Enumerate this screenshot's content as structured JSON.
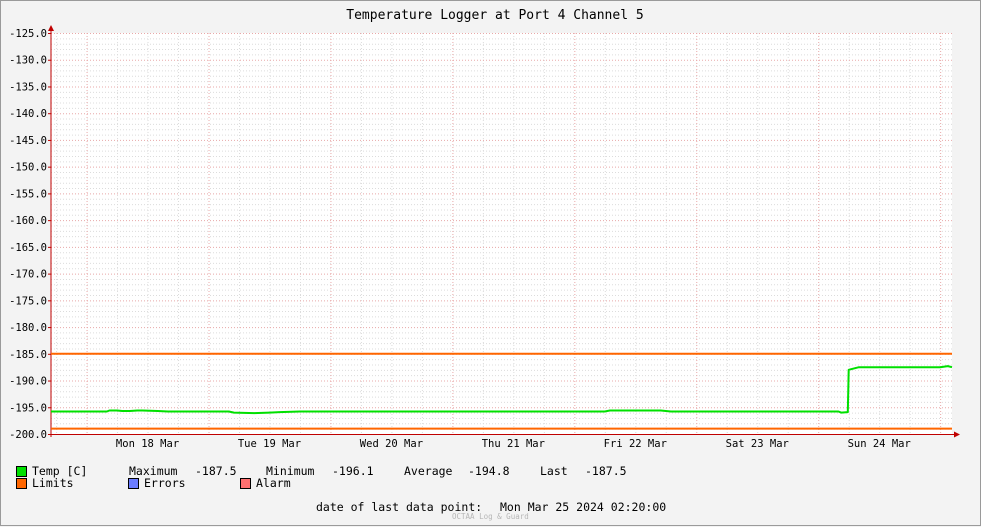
{
  "chart_data": {
    "type": "line",
    "title": "Temperature Logger at Port 4 Channel 5",
    "xlabel": "",
    "ylabel": "",
    "ylim": [
      -200.0,
      -125.0
    ],
    "yticks": [
      -125.0,
      -130.0,
      -135.0,
      -140.0,
      -145.0,
      -150.0,
      -155.0,
      -160.0,
      -165.0,
      -170.0,
      -175.0,
      -180.0,
      -185.0,
      -190.0,
      -195.0,
      -200.0
    ],
    "ytick_labels": [
      "-125.0",
      "-130.0",
      "-135.0",
      "-140.0",
      "-145.0",
      "-150.0",
      "-155.0",
      "-160.0",
      "-165.0",
      "-170.0",
      "-175.0",
      "-180.0",
      "-185.0",
      "-190.0",
      "-195.0",
      "-200.0"
    ],
    "xlim": [
      "2024-03-17 17:00",
      "2024-03-25 02:20"
    ],
    "xticks": [
      "2024-03-18 12:00",
      "2024-03-19 12:00",
      "2024-03-20 12:00",
      "2024-03-21 12:00",
      "2024-03-22 12:00",
      "2024-03-23 12:00",
      "2024-03-24 12:00"
    ],
    "xtick_labels": [
      "Mon 18 Mar",
      "Tue 19 Mar",
      "Wed 20 Mar",
      "Thu 21 Mar",
      "Fri 22 Mar",
      "Sat 23 Mar",
      "Sun 24 Mar"
    ],
    "grid": true,
    "legend_position": "bottom-left",
    "series": [
      {
        "name": "Temp [C]",
        "color": "#00e000",
        "x": [
          "2024-03-17 17:00",
          "2024-03-18 04:00",
          "2024-03-18 04:30",
          "2024-03-18 06:00",
          "2024-03-18 07:00",
          "2024-03-18 08:30",
          "2024-03-18 10:00",
          "2024-03-18 11:00",
          "2024-03-18 14:00",
          "2024-03-18 16:00",
          "2024-03-18 22:00",
          "2024-03-19 04:00",
          "2024-03-19 05:00",
          "2024-03-19 09:00",
          "2024-03-19 12:00",
          "2024-03-19 14:00",
          "2024-03-19 18:00",
          "2024-03-20 12:00",
          "2024-03-21 12:00",
          "2024-03-22 06:00",
          "2024-03-22 07:00",
          "2024-03-22 09:00",
          "2024-03-22 17:00",
          "2024-03-22 19:00",
          "2024-03-23 12:00",
          "2024-03-23 18:00",
          "2024-03-24 04:00",
          "2024-03-24 04:30",
          "2024-03-24 05:50",
          "2024-03-24 06:00",
          "2024-03-24 08:00",
          "2024-03-24 12:00",
          "2024-03-24 18:00",
          "2024-03-25 00:00",
          "2024-03-25 01:30",
          "2024-03-25 02:20"
        ],
        "y": [
          -195.8,
          -195.8,
          -195.6,
          -195.6,
          -195.7,
          -195.7,
          -195.6,
          -195.6,
          -195.7,
          -195.8,
          -195.8,
          -195.8,
          -196.0,
          -196.1,
          -196.0,
          -195.9,
          -195.8,
          -195.8,
          -195.8,
          -195.8,
          -195.6,
          -195.6,
          -195.6,
          -195.8,
          -195.8,
          -195.8,
          -195.8,
          -196.0,
          -195.9,
          -188.0,
          -187.5,
          -187.5,
          -187.5,
          -187.5,
          -187.3,
          -187.5
        ]
      },
      {
        "name": "Limits",
        "color": "#ff6600",
        "levels": [
          -185.0,
          -199.0
        ]
      },
      {
        "name": "Errors",
        "color": "#6b7cff"
      },
      {
        "name": "Alarm",
        "color": "#ff7070"
      }
    ]
  },
  "stats": {
    "maximum_label": "Maximum",
    "maximum": "-187.5",
    "minimum_label": "Minimum",
    "minimum": "-196.1",
    "average_label": "Average",
    "average": "-194.8",
    "last_label": "Last",
    "last": "-187.5"
  },
  "footer": {
    "last_point_label": "date of last data point:",
    "last_point_value": "Mon Mar 25 2024 02:20:00",
    "watermark": "OCTAA Log & Guard"
  }
}
